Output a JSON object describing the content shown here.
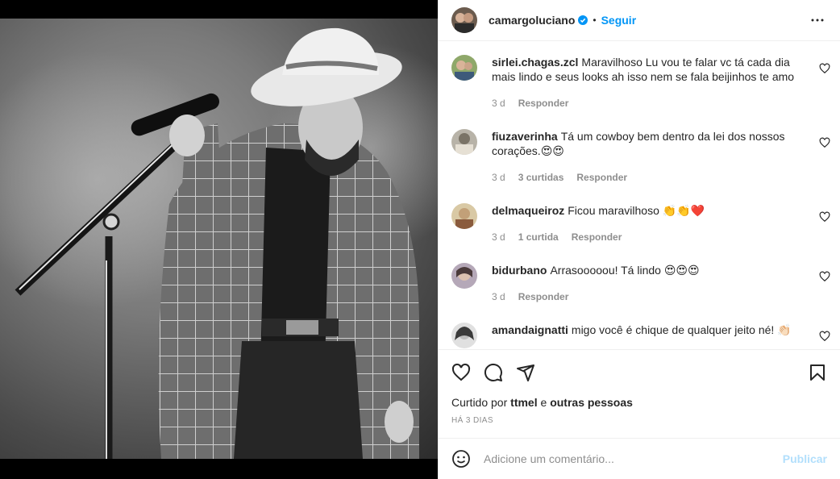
{
  "post": {
    "author": "camargoluciano",
    "follow_label": "Seguir",
    "separator": "•"
  },
  "comments": [
    {
      "user": "sirlei.chagas.zcl",
      "text": "Maravilhoso Lu vou te falar vc tá cada dia mais lindo e seus looks ah isso nem se fala beijinhos te amo",
      "time": "3 d",
      "likes": "",
      "reply": "Responder"
    },
    {
      "user": "fiuzaverinha",
      "text": "Tá um cowboy bem dentro da lei dos nossos corações.😍😍",
      "time": "3 d",
      "likes": "3 curtidas",
      "reply": "Responder"
    },
    {
      "user": "delmaqueiroz",
      "text": "Ficou maravilhoso 👏👏❤️",
      "time": "3 d",
      "likes": "1 curtida",
      "reply": "Responder"
    },
    {
      "user": "bidurbano",
      "text": "Arrasooooou! Tá lindo 😍😍😍",
      "time": "3 d",
      "likes": "",
      "reply": "Responder"
    },
    {
      "user": "amandaignatti",
      "text": "migo você é chique de qualquer jeito né! 👏🏻",
      "time": "",
      "likes": "",
      "reply": ""
    }
  ],
  "likes_line": {
    "prefix": "Curtido por",
    "user": "ttmel",
    "conj": "e",
    "others": "outras pessoas"
  },
  "date": "HÁ 3 DIAS",
  "add_comment": {
    "placeholder": "Adicione um comentário...",
    "publish_label": "Publicar"
  },
  "icons": [
    "heart-icon",
    "comment-icon",
    "share-icon",
    "bookmark-icon",
    "emoji-icon",
    "more-icon",
    "verified-icon"
  ],
  "colors": {
    "accent": "#0095f6",
    "publish_disabled": "#b2dffc",
    "muted": "#8e8e8e",
    "text": "#262626"
  }
}
